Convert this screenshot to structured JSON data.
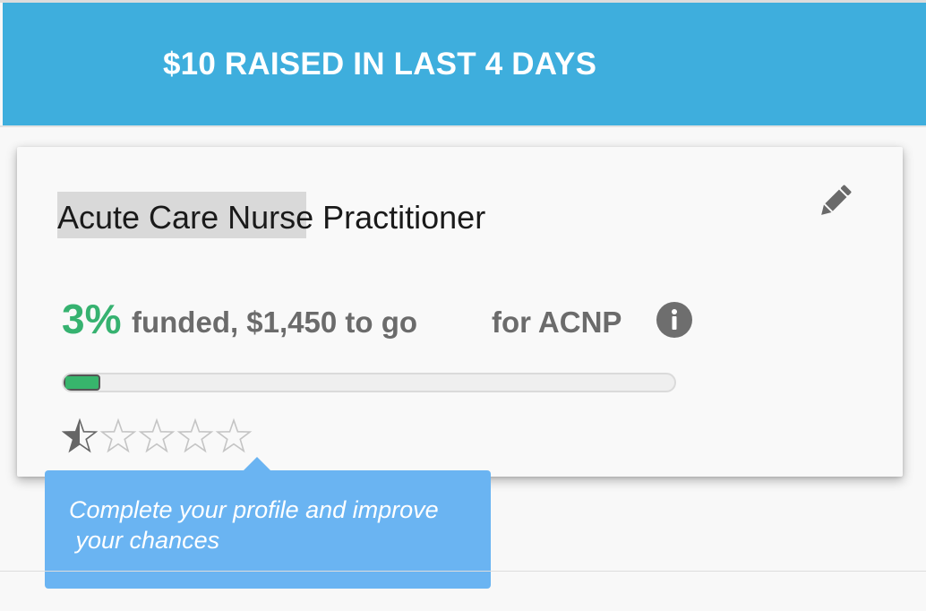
{
  "banner": {
    "text": "$10 RAISED IN LAST 4 DAYS",
    "color": "#3eaedd"
  },
  "card": {
    "title": "Acute Care Nurse Practitioner",
    "edit_icon": "pencil-icon",
    "funding": {
      "percent_text": "3%",
      "funded_text": "funded, $1,450 to go",
      "for_text": "for ACNP",
      "info_icon": "info-icon",
      "progress_fraction": 0.06,
      "accent_color": "#36b270"
    },
    "rating": {
      "value": 0.5,
      "max": 5,
      "icon": "star-icon"
    }
  },
  "tooltip": {
    "text": "Complete your profile and improve\n your chances",
    "color": "#6ab4f2"
  }
}
